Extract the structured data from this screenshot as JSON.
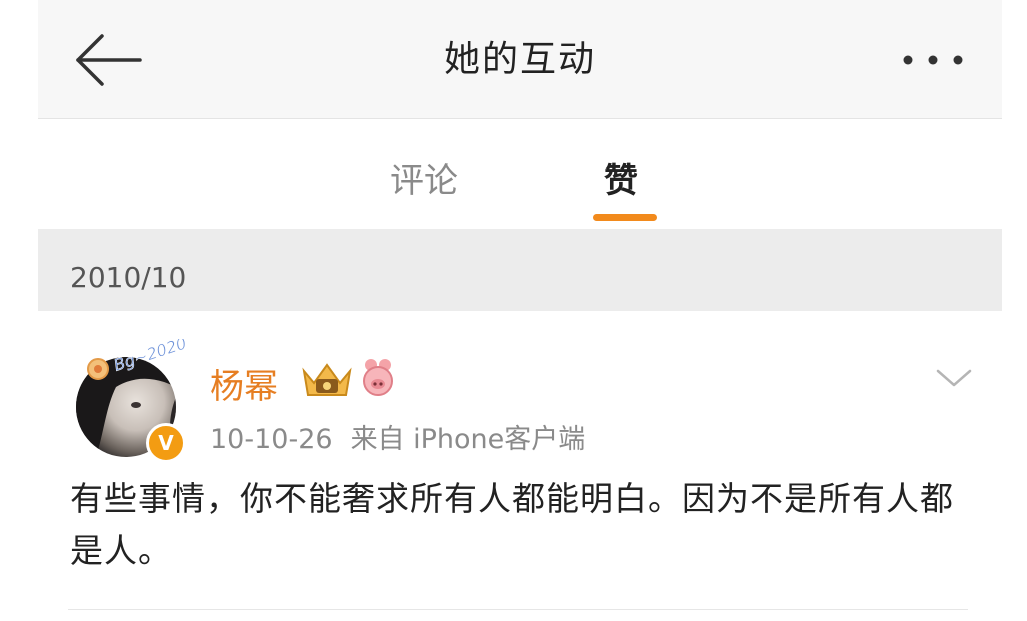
{
  "header": {
    "title": "她的互动",
    "back_icon": "arrow-left-icon",
    "more_icon": "more-dots-icon"
  },
  "tabs": [
    {
      "label": "评论",
      "active": false
    },
    {
      "label": "赞",
      "active": true
    }
  ],
  "accent_color": "#f28a1c",
  "date_group": "2010/10",
  "post": {
    "username": "杨幂",
    "avatar_caption": "Bg~2020",
    "verified_badge": "V",
    "badges": [
      "crown-badge-icon",
      "pig-badge-icon"
    ],
    "timestamp": "10-10-26",
    "source": "来自 iPhone客户端",
    "text": "有些事情，你不能奢求所有人都能明白。因为不是所有人都是人。"
  }
}
